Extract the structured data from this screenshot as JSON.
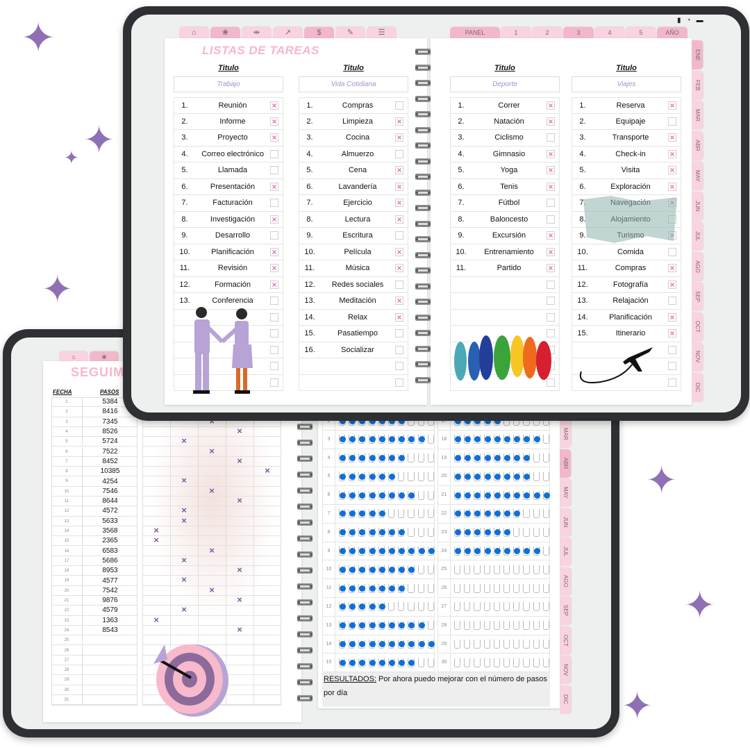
{
  "colors": {
    "accent_pink": "#f2b8ca",
    "check_pink": "#f06fc0",
    "lavender": "#a58fc9",
    "water_blue": "#0f6fd6",
    "tablet_frame": "#2f3033"
  },
  "front": {
    "page_title": "LISTAS DE TAREAS",
    "nav_icons": [
      "home-icon",
      "lotus-icon",
      "dumbbell-icon",
      "chart-line-icon",
      "dollar-icon",
      "notes-icon",
      "sliders-icon"
    ],
    "top_tabs": [
      "PANEL",
      "1",
      "2",
      "3",
      "4",
      "5",
      "AÑO"
    ],
    "months": [
      "ENE",
      "FEB",
      "MAR",
      "ABR",
      "MAY",
      "JUN",
      "JUL",
      "AGO",
      "SEP",
      "OCT",
      "NOV",
      "DIC"
    ],
    "lists": [
      {
        "heading": "Titulo",
        "title": "Trabajo",
        "rows": 18,
        "items": [
          {
            "n": "1.",
            "t": "Reunión",
            "c": true
          },
          {
            "n": "2.",
            "t": "Informe",
            "c": true
          },
          {
            "n": "3.",
            "t": "Proyecto",
            "c": true
          },
          {
            "n": "4.",
            "t": "Correo electrónico",
            "c": false
          },
          {
            "n": "5.",
            "t": "Llamada",
            "c": false
          },
          {
            "n": "6.",
            "t": "Presentación",
            "c": true
          },
          {
            "n": "7.",
            "t": "Facturación",
            "c": false
          },
          {
            "n": "8.",
            "t": "Investigación",
            "c": true
          },
          {
            "n": "9.",
            "t": "Desarrollo",
            "c": false
          },
          {
            "n": "10.",
            "t": "Planificación",
            "c": true
          },
          {
            "n": "11.",
            "t": "Revisión",
            "c": true
          },
          {
            "n": "12.",
            "t": "Formación",
            "c": true
          },
          {
            "n": "13.",
            "t": "Conferencia",
            "c": false
          }
        ]
      },
      {
        "heading": "Titulo",
        "title": "Vida Cotidiana",
        "rows": 18,
        "items": [
          {
            "n": "1.",
            "t": "Compras",
            "c": false
          },
          {
            "n": "2.",
            "t": "Limpieza",
            "c": true
          },
          {
            "n": "3.",
            "t": "Cocina",
            "c": true
          },
          {
            "n": "4.",
            "t": "Almuerzo",
            "c": false
          },
          {
            "n": "5.",
            "t": "Cena",
            "c": true
          },
          {
            "n": "6.",
            "t": "Lavandería",
            "c": true
          },
          {
            "n": "7.",
            "t": "Ejercicio",
            "c": true
          },
          {
            "n": "8.",
            "t": "Lectura",
            "c": true
          },
          {
            "n": "9.",
            "t": "Escritura",
            "c": false
          },
          {
            "n": "10.",
            "t": "Película",
            "c": true
          },
          {
            "n": "11.",
            "t": "Música",
            "c": true
          },
          {
            "n": "12.",
            "t": "Redes sociales",
            "c": false
          },
          {
            "n": "13.",
            "t": "Meditación",
            "c": true
          },
          {
            "n": "14.",
            "t": "Relax",
            "c": true
          },
          {
            "n": "15.",
            "t": "Pasatiempo",
            "c": false
          },
          {
            "n": "16.",
            "t": "Socializar",
            "c": false
          }
        ]
      },
      {
        "heading": "Titulo",
        "title": "Deporte",
        "rows": 18,
        "items": [
          {
            "n": "1.",
            "t": "Correr",
            "c": true
          },
          {
            "n": "2.",
            "t": "Natación",
            "c": true
          },
          {
            "n": "3.",
            "t": "Ciclismo",
            "c": false
          },
          {
            "n": "4.",
            "t": "Gimnasio",
            "c": true
          },
          {
            "n": "5.",
            "t": "Yoga",
            "c": true
          },
          {
            "n": "6.",
            "t": "Tenis",
            "c": true
          },
          {
            "n": "7.",
            "t": "Fútbol",
            "c": false
          },
          {
            "n": "8.",
            "t": "Baloncesto",
            "c": false
          },
          {
            "n": "9.",
            "t": "Excursión",
            "c": true
          },
          {
            "n": "10.",
            "t": "Entrenamiento",
            "c": true
          },
          {
            "n": "11.",
            "t": "Partido",
            "c": true
          }
        ]
      },
      {
        "heading": "Titulo",
        "title": "Viajes",
        "rows": 18,
        "items": [
          {
            "n": "1.",
            "t": "Reserva",
            "c": true
          },
          {
            "n": "2.",
            "t": "Equipaje",
            "c": false
          },
          {
            "n": "3.",
            "t": "Transporte",
            "c": true
          },
          {
            "n": "4.",
            "t": "Check-in",
            "c": true
          },
          {
            "n": "5.",
            "t": "Visita",
            "c": true
          },
          {
            "n": "6.",
            "t": "Exploración",
            "c": true
          },
          {
            "n": "7.",
            "t": "Navegación",
            "c": true
          },
          {
            "n": "8.",
            "t": "Alojamiento",
            "c": false
          },
          {
            "n": "9.",
            "t": "Turismo",
            "c": true
          },
          {
            "n": "10.",
            "t": "Comida",
            "c": false
          },
          {
            "n": "11.",
            "t": "Compras",
            "c": true
          },
          {
            "n": "12.",
            "t": "Fotografía",
            "c": true
          },
          {
            "n": "13.",
            "t": "Relajación",
            "c": false
          },
          {
            "n": "14.",
            "t": "Planificación",
            "c": true
          },
          {
            "n": "15.",
            "t": "Itinerario",
            "c": true
          }
        ]
      }
    ]
  },
  "back": {
    "page_title": "SEGUIME",
    "fecha_header": "FECHA",
    "pasos_header": "PASOS",
    "steps": [
      "5384",
      "8416",
      "7345",
      "8526",
      "5724",
      "7522",
      "8452",
      "10385",
      "4254",
      "7546",
      "8644",
      "4572",
      "5633",
      "3568",
      "2365",
      "6583",
      "5686",
      "8953",
      "4577",
      "7542",
      "9876",
      "4579",
      "1363",
      "8543",
      "",
      "",
      "",
      "",
      "",
      "",
      ""
    ],
    "marks": {
      "3": 2,
      "4": 3,
      "5": 1,
      "6": 2,
      "7": 3,
      "8": 4,
      "9": 1,
      "10": 2,
      "11": 3,
      "12": 1,
      "13": 1,
      "14": 0,
      "15": 0,
      "16": 2,
      "17": 1,
      "18": 3,
      "19": 1,
      "20": 2,
      "21": 3,
      "22": 1,
      "23": 0,
      "24": 3
    },
    "months": [
      "MAR",
      "ABR",
      "MAY",
      "JUN",
      "JUL",
      "AGO",
      "SEP",
      "OCT",
      "NOV",
      "DIC"
    ],
    "water_total": 10,
    "water_left": [
      [
        "2",
        7
      ],
      [
        "3",
        9
      ],
      [
        "4",
        7
      ],
      [
        "5",
        6
      ],
      [
        "6",
        8
      ],
      [
        "7",
        5
      ],
      [
        "8",
        7
      ],
      [
        "9",
        10
      ],
      [
        "10",
        8
      ],
      [
        "11",
        7
      ],
      [
        "12",
        5
      ],
      [
        "13",
        9
      ],
      [
        "14",
        10
      ],
      [
        "15",
        8
      ]
    ],
    "water_right": [
      [
        "17",
        5
      ],
      [
        "18",
        9
      ],
      [
        "19",
        8
      ],
      [
        "20",
        8
      ],
      [
        "21",
        10
      ],
      [
        "22",
        7
      ],
      [
        "23",
        6
      ],
      [
        "24",
        9
      ],
      [
        "25",
        0
      ],
      [
        "26",
        0
      ],
      [
        "27",
        0
      ],
      [
        "28",
        0
      ],
      [
        "29",
        0
      ],
      [
        "30",
        0
      ]
    ],
    "results_label": "RESULTADOS:",
    "results_text": " Por ahora puedo mejorar con el número de pasos por día"
  }
}
